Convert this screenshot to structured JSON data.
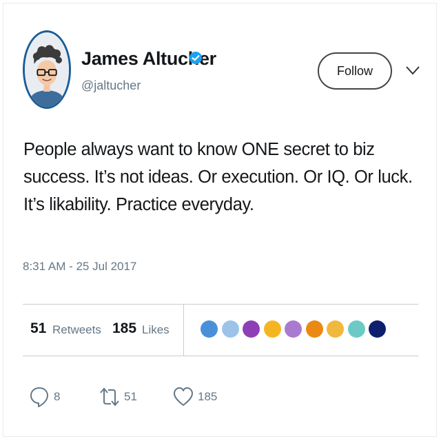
{
  "user": {
    "name": "James Altucher",
    "handle": "@jaltucher",
    "verified": true,
    "accent_color": "#1da1f2"
  },
  "follow_label": "Follow",
  "tweet": {
    "text": "People always want to know ONE secret to biz success. It’s not ideas. Or execution. Or IQ. Or luck. It’s likability. Practice everyday.",
    "timestamp": "8:31 AM - 25 Jul 2017"
  },
  "stats": {
    "retweets_count": "51",
    "retweets_label": "Retweets",
    "likes_count": "185",
    "likes_label": "Likes"
  },
  "liker_avatar_colors": [
    "#4a90d9",
    "#9cc3e8",
    "#8e3fb5",
    "#f5b523",
    "#a97bd0",
    "#ea8a12",
    "#f0b83c",
    "#6ccac4",
    "#0e1f6e"
  ],
  "actions": {
    "reply_count": "8",
    "retweet_count": "51",
    "like_count": "185"
  },
  "icons": [
    "verified-badge-icon",
    "chevron-down-icon",
    "reply-icon",
    "retweet-icon",
    "heart-icon"
  ]
}
